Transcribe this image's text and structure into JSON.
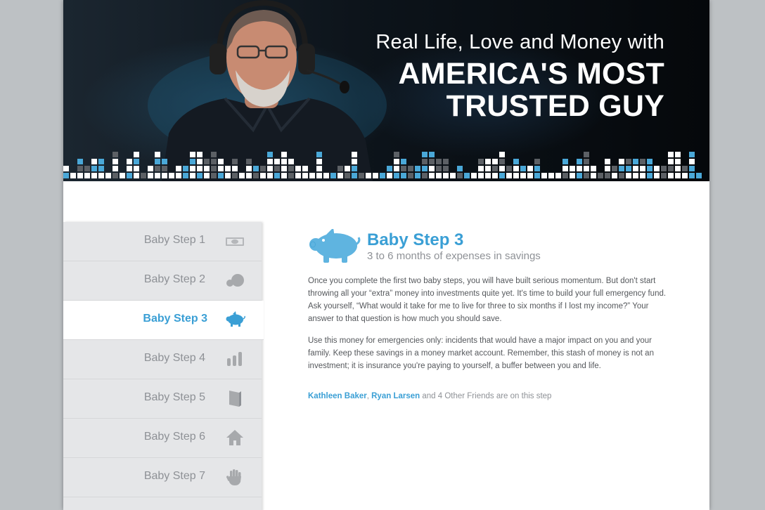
{
  "hero": {
    "line1": "Real Life, Love and Money with",
    "line2": "AMERICA'S MOST",
    "line3": "TRUSTED GUY"
  },
  "sidebar": {
    "items": [
      {
        "label": "Baby Step 1",
        "icon": "money-bill-icon",
        "active": false
      },
      {
        "label": "Baby Step 2",
        "icon": "snowball-icon",
        "active": false
      },
      {
        "label": "Baby Step 3",
        "icon": "piggy-bank-icon",
        "active": true
      },
      {
        "label": "Baby Step 4",
        "icon": "bar-chart-icon",
        "active": false
      },
      {
        "label": "Baby Step 5",
        "icon": "book-icon",
        "active": false
      },
      {
        "label": "Baby Step 6",
        "icon": "house-icon",
        "active": false
      },
      {
        "label": "Baby Step 7",
        "icon": "hand-icon",
        "active": false
      }
    ]
  },
  "content": {
    "title": "Baby Step 3",
    "subtitle": "3 to 6 months of expenses in savings",
    "paragraph1": "Once you complete the first two baby steps, you will have built serious momentum. But don't start throwing all your “extra” money into investments quite yet. It's time to build your full emergency fund. Ask yourself, “What would it take for me to live for three to six months if I lost my income?” Your answer to that question is how much you should save.",
    "paragraph2": "Use this money for emergencies only: incidents that would have a major impact on you and your family. Keep these savings in a money market account. Remember, this stash of money is not an investment; it is insurance you're paying to yourself, a buffer between you and life.",
    "friends": {
      "friend1": "Kathleen Baker",
      "separator": ", ",
      "friend2": "Ryan Larsen",
      "rest": " and 4 Other Friends are on this step"
    }
  },
  "colors": {
    "accent": "#3a9fd5",
    "muted_text": "#8e9196",
    "sidebar_bg": "#e5e6e8",
    "hero_bg": "#0b1117",
    "pixel_blue": "#4aa8d8",
    "pixel_gray": "#5c6065",
    "pixel_white": "#ffffff"
  }
}
